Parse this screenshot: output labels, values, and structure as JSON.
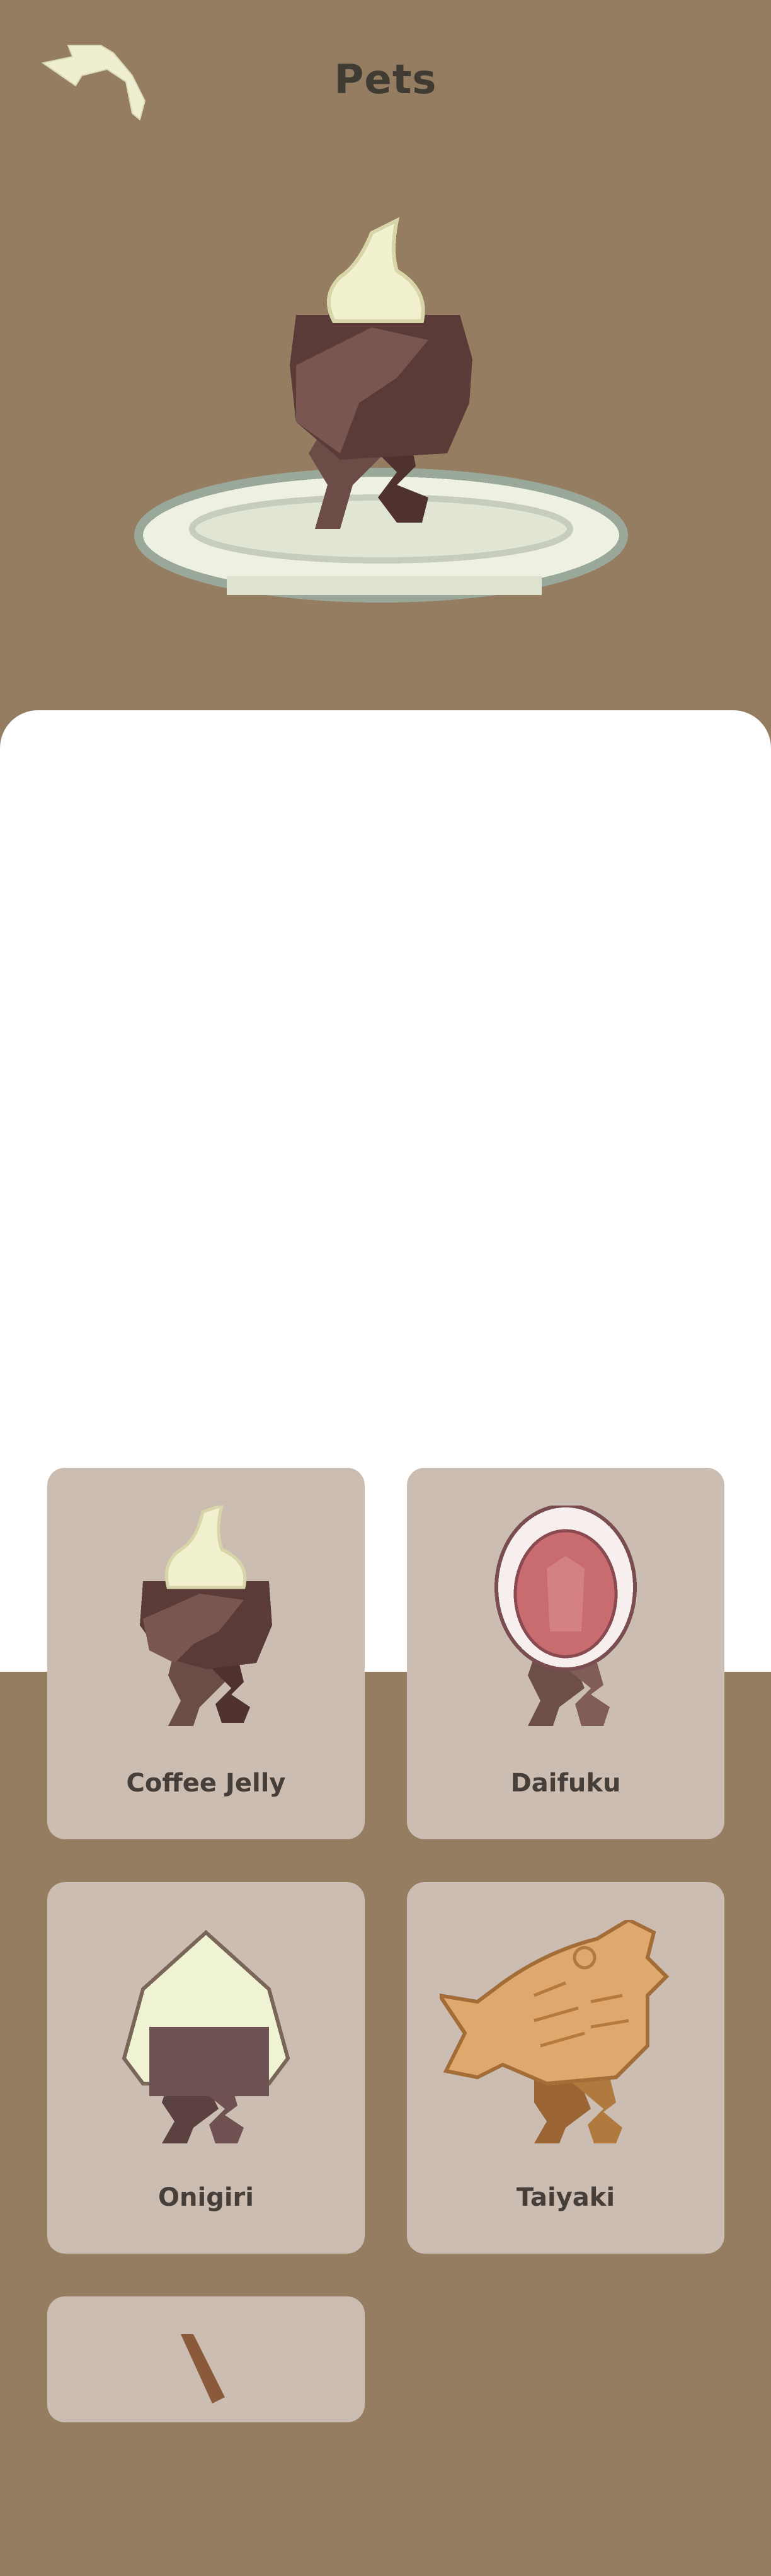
{
  "header": {
    "title": "Pets",
    "back_icon": "back-arrow-icon"
  },
  "hero": {
    "pet": "Coffee Jelly"
  },
  "pets": [
    {
      "name": "Coffee Jelly",
      "icon": "coffee-jelly-icon"
    },
    {
      "name": "Daifuku",
      "icon": "daifuku-icon"
    },
    {
      "name": "Onigiri",
      "icon": "onigiri-icon"
    },
    {
      "name": "Taiyaki",
      "icon": "taiyaki-icon"
    },
    {
      "name": "",
      "icon": "stick-treat-icon"
    }
  ],
  "colors": {
    "header_bg": "#957d62",
    "sheet_bg": "#ffffff",
    "card_bg": "#cbbdb1",
    "title_text": "#3f3a32",
    "label_text": "#463e38"
  }
}
